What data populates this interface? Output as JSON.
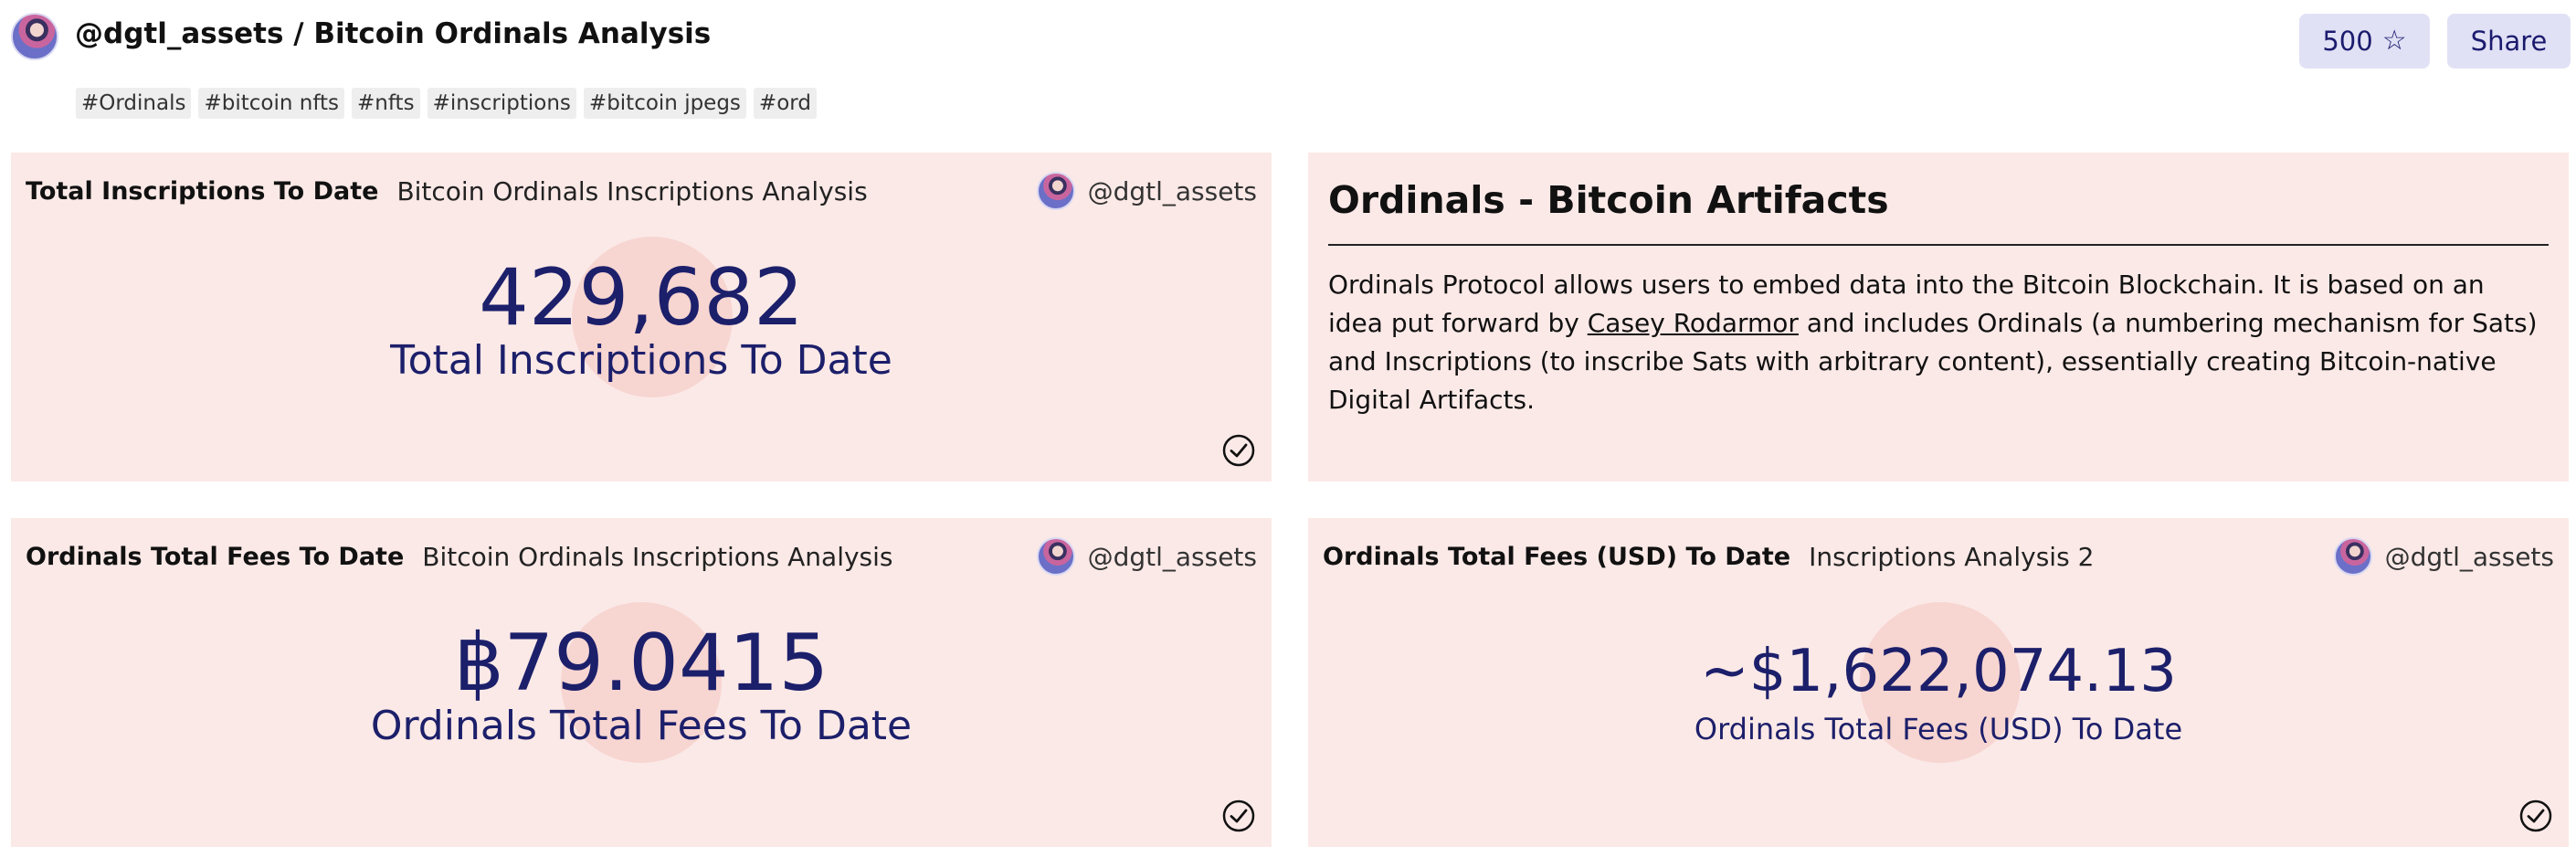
{
  "header": {
    "title": "@dgtl_assets / Bitcoin Ordinals Analysis",
    "tags": [
      "#Ordinals",
      "#bitcoin nfts",
      "#nfts",
      "#inscriptions",
      "#bitcoin jpegs",
      "#ord"
    ],
    "star_count": "500",
    "share_label": "Share"
  },
  "widgets": {
    "total_inscriptions": {
      "vis_name": "Total Inscriptions To Date",
      "query_name": "Bitcoin Ordinals Inscriptions Analysis",
      "author": "@dgtl_assets",
      "value": "429,682",
      "label": "Total Inscriptions To Date"
    },
    "about": {
      "title": "Ordinals - Bitcoin Artifacts",
      "body_before": "Ordinals Protocol allows users to embed data into the Bitcoin Blockchain. It is based on an idea put forward by ",
      "link_text": "Casey Rodarmor",
      "body_after": " and includes Ordinals (a numbering mechanism for Sats) and Inscriptions (to inscribe Sats with arbitrary content), essentially creating Bitcoin-native Digital Artifacts."
    },
    "total_fees_btc": {
      "vis_name": "Ordinals Total Fees To Date",
      "query_name": "Bitcoin Ordinals Inscriptions Analysis",
      "author": "@dgtl_assets",
      "value": "฿79.0415",
      "label": "Ordinals Total Fees To Date"
    },
    "total_fees_usd": {
      "vis_name": "Ordinals Total Fees (USD) To Date",
      "query_name": "Inscriptions Analysis 2",
      "author": "@dgtl_assets",
      "value": "~$1,622,074.13",
      "label": "Ordinals Total Fees (USD) To Date"
    }
  },
  "icons": {
    "star": "star-icon",
    "check": "check-circle-icon",
    "avatar": "avatar"
  },
  "colors": {
    "card_background": "#fbe9e7",
    "counter_text": "#1c1f6a",
    "button_background": "#e1e1f6"
  }
}
